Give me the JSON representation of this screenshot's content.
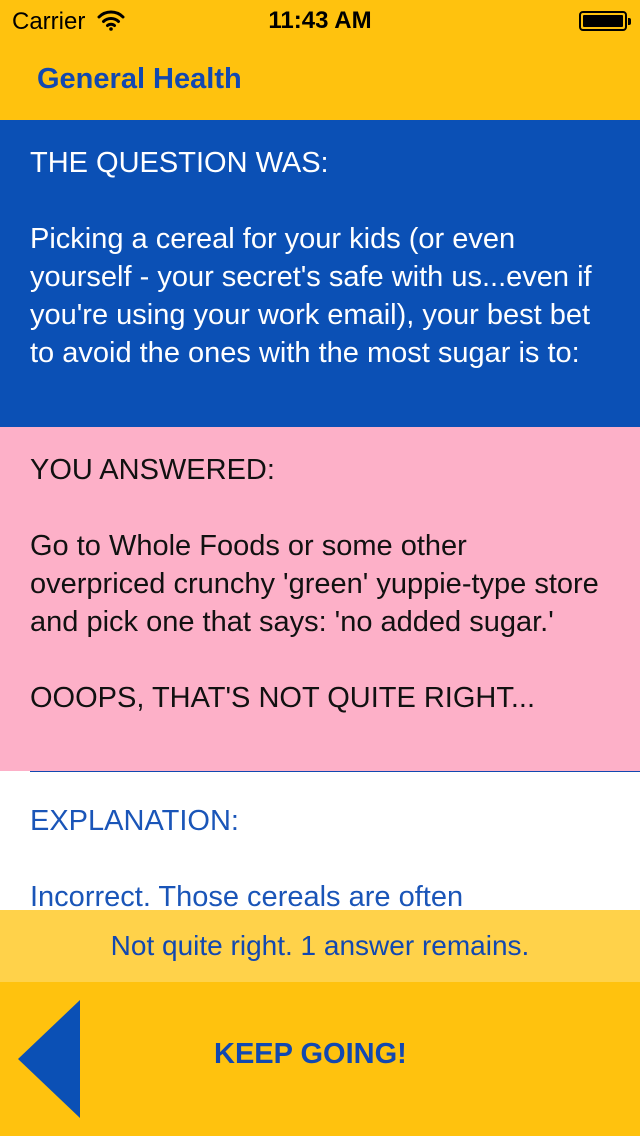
{
  "status_bar": {
    "carrier": "Carrier",
    "time": "11:43 AM",
    "icons": [
      "wifi-icon",
      "battery-icon"
    ]
  },
  "nav": {
    "title": "General Health"
  },
  "question": {
    "heading": "THE QUESTION WAS:",
    "text": "Picking a cereal for your kids (or even yourself - your secret's safe with us...even if you're using your work email), your best bet to avoid the ones with the most sugar is to:"
  },
  "answer": {
    "heading": "YOU ANSWERED:",
    "text": "Go to Whole Foods or some other overpriced crunchy 'green' yuppie-type store and pick one that says: 'no added sugar.'",
    "verdict": "OOOPS, THAT'S NOT QUITE RIGHT..."
  },
  "explanation": {
    "heading": "EXPLANATION:",
    "text": "Incorrect. Those cereals are often"
  },
  "feedback": {
    "text": "Not quite right. 1 answer remains."
  },
  "footer": {
    "keep_going_label": "KEEP GOING!",
    "back_icon": "left-triangle-icon"
  },
  "colors": {
    "yellow": "#FFC20E",
    "blue": "#0B50B5",
    "pink": "#FDB0C8",
    "light_yellow": "#FFD24A",
    "text_blue": "#1248B0"
  }
}
